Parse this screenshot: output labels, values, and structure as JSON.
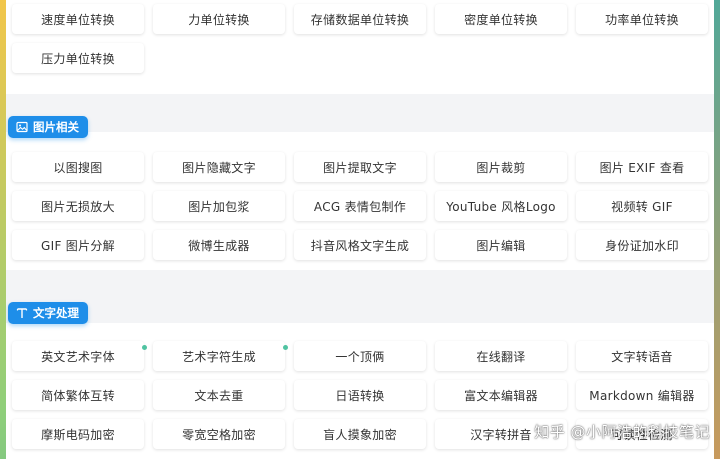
{
  "sections": {
    "units": {
      "items": [
        "速度单位转换",
        "力单位转换",
        "存储数据单位转换",
        "密度单位转换",
        "功率单位转换",
        "压力单位转换"
      ]
    },
    "image": {
      "title": "图片相关",
      "icon": "image-icon",
      "items": [
        "以图搜图",
        "图片隐藏文字",
        "图片提取文字",
        "图片裁剪",
        "图片 EXIF 查看",
        "图片无损放大",
        "图片加包浆",
        "ACG 表情包制作",
        "YouTube 风格Logo",
        "视频转 GIF",
        "GIF 图片分解",
        "微博生成器",
        "抖音风格文字生成",
        "图片编辑",
        "身份证加水印"
      ]
    },
    "text": {
      "title": "文字处理",
      "icon": "text-icon",
      "items": [
        "英文艺术字体",
        "艺术字符生成",
        "一个顶俩",
        "在线翻译",
        "文字转语音",
        "简体繁体互转",
        "文本去重",
        "日语转换",
        "富文本编辑器",
        "Markdown 编辑器",
        "摩斯电码加密",
        "零宽空格加密",
        "盲人摸象加密",
        "汉字转拼音",
        "可读性检测"
      ],
      "new_dot_items": [
        0,
        1
      ]
    }
  },
  "colors": {
    "accent": "#1e8ee9",
    "new_dot": "#4fc3a1"
  },
  "watermark": "知乎 @小阿浩的科技笔记"
}
